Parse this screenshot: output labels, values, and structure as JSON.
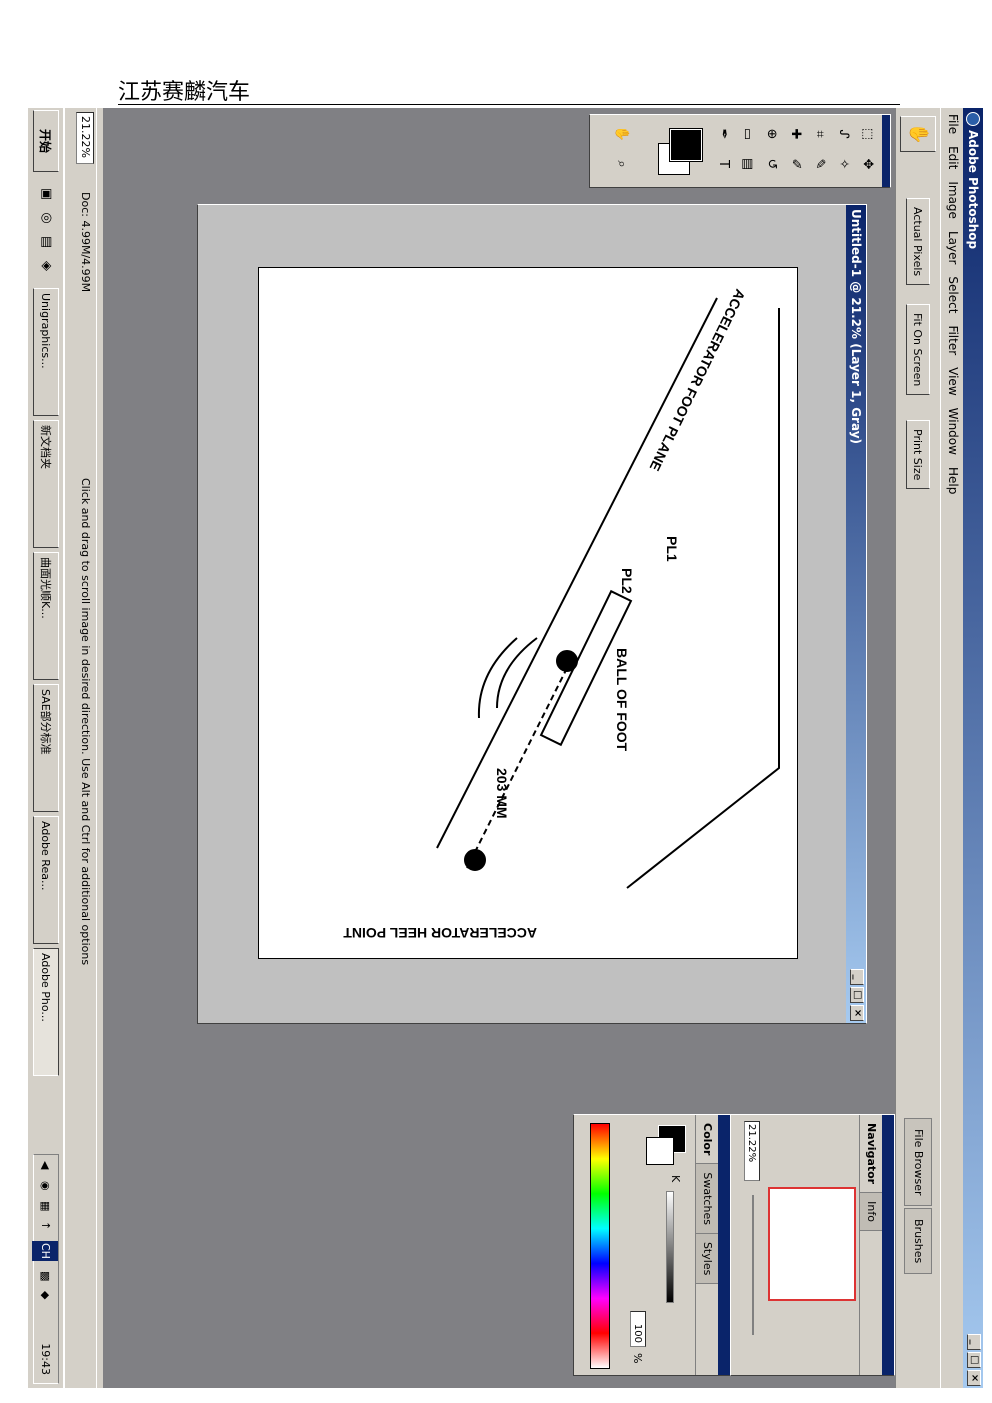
{
  "doc_header": "江苏赛麟汽车",
  "app": {
    "title": "Adobe Photoshop",
    "menus": [
      "File",
      "Edit",
      "Image",
      "Layer",
      "Select",
      "Filter",
      "View",
      "Window",
      "Help"
    ]
  },
  "options_bar": {
    "buttons": [
      "Actual Pixels",
      "Fit On Screen",
      "Print Size"
    ],
    "palette_well": [
      "File Browser",
      "Brushes"
    ]
  },
  "document": {
    "title": "Untitled-1 @ 21.2% (Layer 1, Gray)",
    "figure_labels": {
      "plane": "ACCELERATOR FOOT PLANE",
      "pl1": "PL1",
      "pl2": "PL2",
      "ball": "BALL OF FOOT",
      "dimension": "203 MM",
      "heel": "ACCELERATOR HEEL POINT"
    }
  },
  "navigator": {
    "tabs": [
      "Navigator",
      "Info"
    ],
    "zoom": "21.22%"
  },
  "color_palette": {
    "tabs": [
      "Color",
      "Swatches",
      "Styles"
    ],
    "channel_label": "K",
    "value": "100",
    "unit": "%"
  },
  "status_bar": {
    "zoom": "21.22%",
    "doc_size": "Doc: 4.99M/4.99M",
    "hint": "Click and drag to scroll image in desired direction.  Use Alt and Ctrl for additional options"
  },
  "taskbar": {
    "start": "开始",
    "buttons": [
      "Unigraphics...",
      "新文档夹",
      "曲面光顺K...",
      "SAE部分标准",
      "Adobe Rea...",
      "Adobe Pho..."
    ],
    "clock": "19:43",
    "ime": "CH"
  }
}
